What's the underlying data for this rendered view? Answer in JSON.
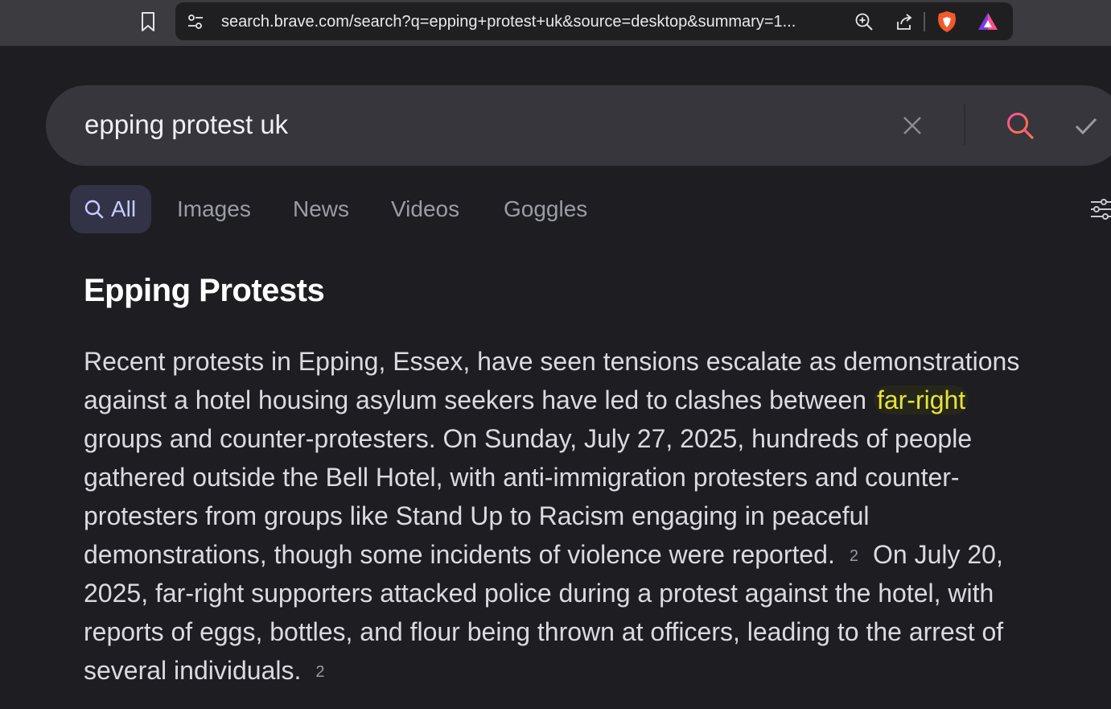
{
  "browser": {
    "url": "search.brave.com/search?q=epping+protest+uk&source=desktop&summary=1..."
  },
  "search": {
    "query": "epping protest uk"
  },
  "tabs": [
    {
      "label": "All"
    },
    {
      "label": "Images"
    },
    {
      "label": "News"
    },
    {
      "label": "Videos"
    },
    {
      "label": "Goggles"
    }
  ],
  "summary": {
    "title": "Epping Protests",
    "lines": [
      "Recent protests in Epping, Essex, have seen tensions escalate as demonstrations",
      "against a hotel housing asylum seekers have led to clashes between ",
      "groups and counter-protesters. On Sunday, July 27, 2025, hundreds of people",
      "gathered outside the Bell Hotel, with anti-immigration protesters and counter-",
      "protesters from groups like Stand Up to Racism engaging in peaceful",
      "demonstrations, though some incidents of violence were reported.",
      "On July 20,",
      "2025, far-right supporters attacked police during a protest against the hotel, with",
      "reports of eggs, bottles, and flour being thrown at officers, leading to the arrest of",
      "several individuals."
    ],
    "highlight": "far-right",
    "citation_1": "2",
    "citation_2": "2"
  },
  "colors": {
    "background": "#1d1d22",
    "accent": "#c8cbff",
    "highlight": "#e4e43a",
    "search_gradient_start": "#ff4f9a",
    "search_gradient_end": "#ff7a3a"
  },
  "icons": [
    "bookmark-icon",
    "site-settings-icon",
    "zoom-icon",
    "share-icon",
    "brave-shields-icon",
    "brave-rewards-icon",
    "close-icon",
    "search-icon",
    "check-icon",
    "filter-icon"
  ]
}
